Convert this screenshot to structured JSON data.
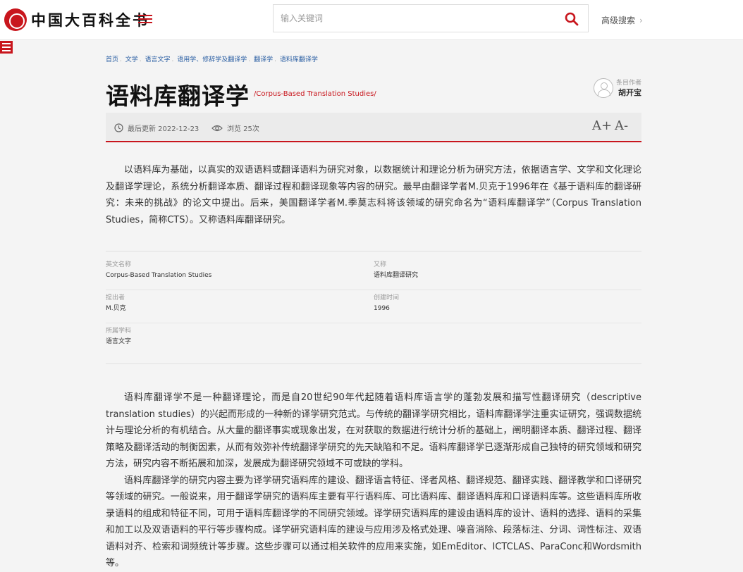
{
  "header": {
    "logo_text": "中国大百科全书",
    "search_placeholder": "输入关键词",
    "advanced_search": "高级搜索",
    "advanced_chevron": "›",
    "icons": {
      "menu": "hamburger-icon",
      "search": "search-icon",
      "sidebar": "sidebar-menu-icon"
    },
    "accent_color": "#c8161d"
  },
  "breadcrumb": [
    "首页",
    "文学",
    "语言文字",
    "语用学、修辞学及翻译学",
    "翻译学",
    "语料库翻译学"
  ],
  "article": {
    "title": "语料库翻译学",
    "title_en": "/Corpus-Based Translation Studies/",
    "author_label": "条目作者",
    "author_name": "胡开宝",
    "updated_label": "最后更新 2022-12-23",
    "views_label": "浏览 25次",
    "font_increase": "A+",
    "font_decrease": "A-",
    "intro": "以语料库为基础，以真实的双语语料或翻译语料为研究对象，以数据统计和理论分析为研究方法，依据语言学、文学和文化理论及翻译学理论，系统分析翻译本质、翻译过程和翻译现象等内容的研究。最早由翻译学者M.贝克于1996年在《基于语料库的翻译研究：未来的挑战》的论文中提出。后来，美国翻译学者M.季莫志科将该领域的研究命名为“语料库翻译学”（Corpus Translation Studies，简称CTS）。又称语料库翻译研究。",
    "info": {
      "en_name_label": "英文名称",
      "en_name": "Corpus-Based Translation Studies",
      "alias_label": "又称",
      "alias": "语料库翻译研究",
      "proposer_label": "提出者",
      "proposer": "M.贝克",
      "created_label": "创建时间",
      "created": "1996",
      "discipline_label": "所属学科",
      "discipline": "语言文字"
    },
    "body": [
      "语料库翻译学不是一种翻译理论，而是自20世纪90年代起随着语料库语言学的蓬勃发展和描写性翻译研究（descriptive translation studies）的兴起而形成的一种新的译学研究范式。与传统的翻译学研究相比，语料库翻译学注重实证研究，强调数据统计与理论分析的有机结合。从大量的翻译事实或现象出发，在对获取的数据进行统计分析的基础上，阐明翻译本质、翻译过程、翻译策略及翻译活动的制衡因素，从而有效弥补传统翻译学研究的先天缺陷和不足。语料库翻译学已逐渐形成自己独特的研究领域和研究方法，研究内容不断拓展和加深，发展成为翻译研究领域不可或缺的学科。",
      "语料库翻译学的研究内容主要为译学研究语料库的建设、翻译语言特征、译者风格、翻译规范、翻译实践、翻译教学和口译研究等领域的研究。一般说来，用于翻译学研究的语料库主要有平行语料库、可比语料库、翻译语料库和口译语料库等。这些语料库所收录语料的组成和特征不同，可用于语料库翻译学的不同研究领域。译学研究语料库的建设由语料库的设计、语料的选择、语料的采集和加工以及双语语料的平行等步骤构成。译学研究语料库的建设与应用涉及格式处理、噪音消除、段落标注、分词、词性标注、双语语料对齐、检索和词频统计等步骤。这些步骤可以通过相关软件的应用来实施，如EmEditor、ICTCLAS、ParaConc和Wordsmith等。"
    ]
  }
}
